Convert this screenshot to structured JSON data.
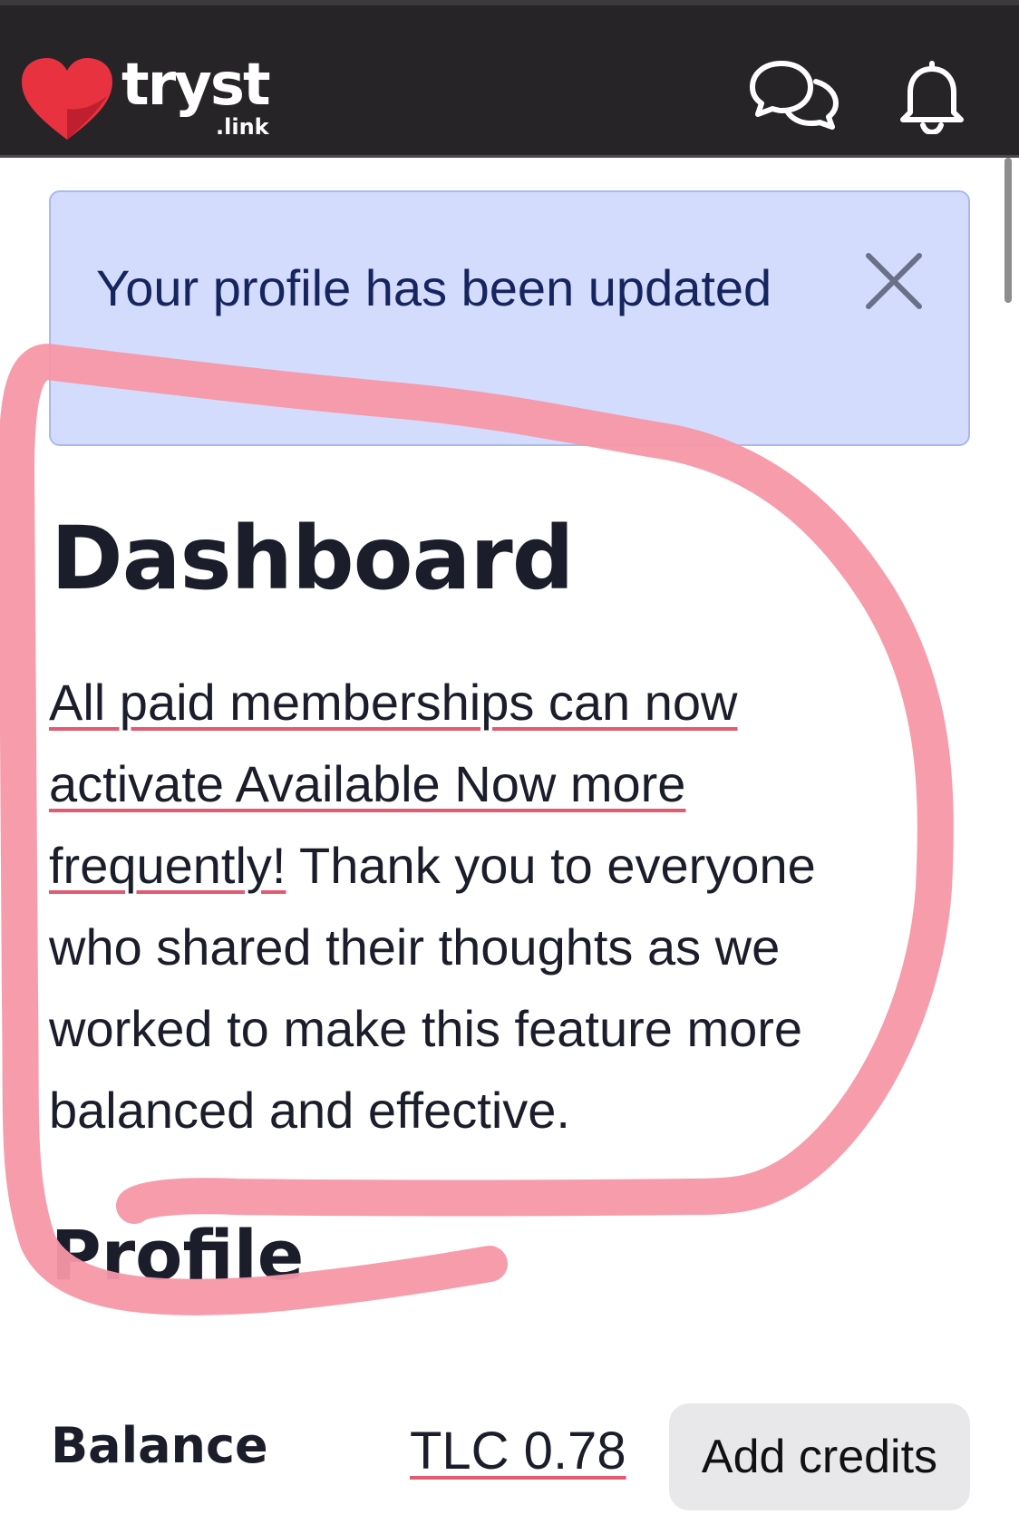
{
  "header": {
    "logo": {
      "name": "tryst",
      "tld": ".link"
    },
    "icons": {
      "messages": "chat-bubbles-icon",
      "notifications": "bell-icon"
    }
  },
  "alert": {
    "message": "Your profile has been updated",
    "close_icon": "close-icon"
  },
  "dashboard": {
    "title": "Dashboard",
    "announcement": {
      "link_text": "All paid memberships can now activate Available Now more frequently!",
      "body_text": " Thank you to everyone who shared their thoughts as we worked to make this feature more balanced and effective."
    }
  },
  "profile": {
    "title": "Profile",
    "balance_label": "Balance",
    "balance_value": "TLC 0.78",
    "add_credits_label": "Add credits"
  },
  "colors": {
    "header_bg": "#262427",
    "brand_red": "#e8323f",
    "alert_bg": "#d3dcfd",
    "alert_text": "#16255f",
    "link_underline": "#e25b72",
    "annotation": "#f797a6"
  }
}
